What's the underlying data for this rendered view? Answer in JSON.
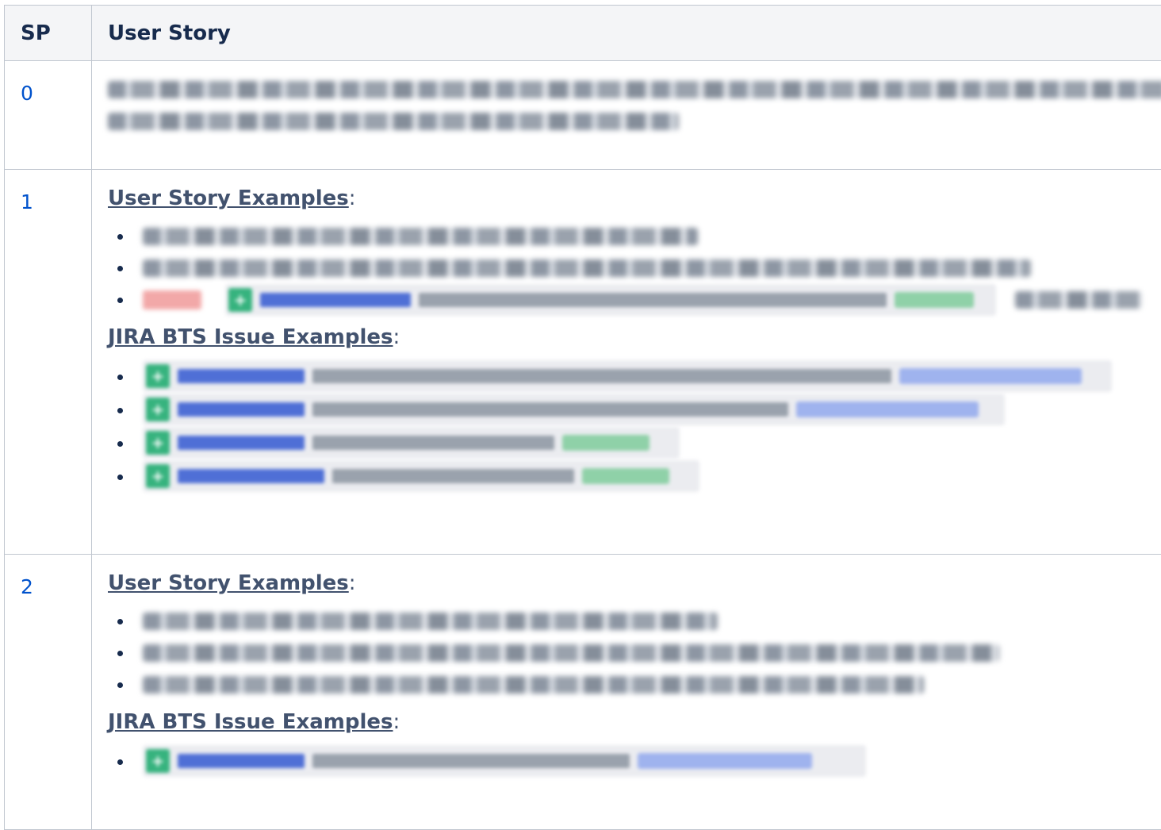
{
  "table": {
    "headers": {
      "sp": "SP",
      "story": "User Story"
    },
    "rows": [
      {
        "sp": "0"
      },
      {
        "sp": "1",
        "user_story_heading": "User Story Examples",
        "jira_heading": "JIRA BTS Issue Examples",
        "heading_suffix": ":"
      },
      {
        "sp": "2",
        "user_story_heading": "User Story Examples",
        "jira_heading": "JIRA BTS Issue Examples",
        "heading_suffix": ":"
      }
    ]
  },
  "colors": {
    "header_bg": "#f4f5f7",
    "border": "#c1c7d0",
    "sp_value": "#0052cc",
    "heading": "#42526e",
    "issue_icon": "#36b37e"
  },
  "icons": {
    "issue_type": "story-icon"
  }
}
